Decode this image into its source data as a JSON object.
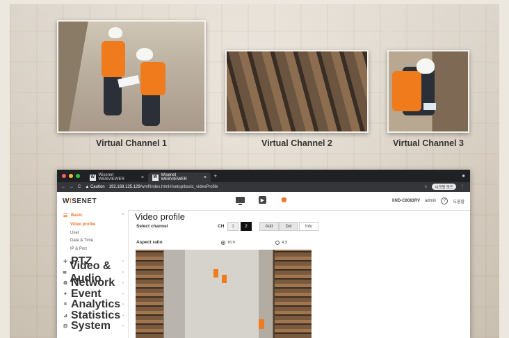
{
  "captions": {
    "channel1": "Virtual Channel 1",
    "channel2": "Virtual Channel 2",
    "channel3": "Virtual Channel 3"
  },
  "browser": {
    "tabs": [
      {
        "label": "Wisenet WEBVIEWER",
        "active": false
      },
      {
        "label": "Wisenet WEBVIEWER",
        "active": true
      }
    ],
    "tab_icon_letter": "W",
    "tab_close": "×",
    "new_tab": "+",
    "nav": {
      "back": "←",
      "forward": "→",
      "reload": "C"
    },
    "caution_label": "▲ Caution",
    "url_host": "192.168.125.129",
    "url_path": "/wmf/index.html#/setup/basic_videoProfile",
    "star": "☆",
    "profile_pill": "시크릿 모드",
    "menu_dots": "⋮"
  },
  "app": {
    "logo_prefix": "W",
    "logo_i": "I",
    "logo_suffix": "SENET",
    "model": "XND-C8083RV",
    "user": "admin",
    "help": "?",
    "help_label": "도움말"
  },
  "sidebar": {
    "groups": [
      {
        "label": "Basic",
        "icon": "list-icon",
        "active": true,
        "items": [
          "Video profile",
          "User",
          "Date & Time",
          "IP & Port"
        ]
      },
      {
        "label": "PTZ"
      },
      {
        "label": "Video & Audio"
      },
      {
        "label": "Network"
      },
      {
        "label": "Event"
      },
      {
        "label": "Analytics"
      },
      {
        "label": "Statistics"
      },
      {
        "label": "System"
      }
    ],
    "chevron_open": "^",
    "chevron_closed": "›"
  },
  "main": {
    "title": "Video profile",
    "select_channel_label": "Select channel",
    "ch_label": "CH",
    "channels": [
      "1",
      "2"
    ],
    "selected_channel": "2",
    "buttons": {
      "add": "Add",
      "del": "Del",
      "info": "Info"
    },
    "aspect_label": "Aspect ratio",
    "aspect_options": [
      "16:9",
      "4:3"
    ],
    "aspect_selected": "16:9"
  },
  "colors": {
    "accent": "#e8772e",
    "titlebar": "#202124"
  }
}
